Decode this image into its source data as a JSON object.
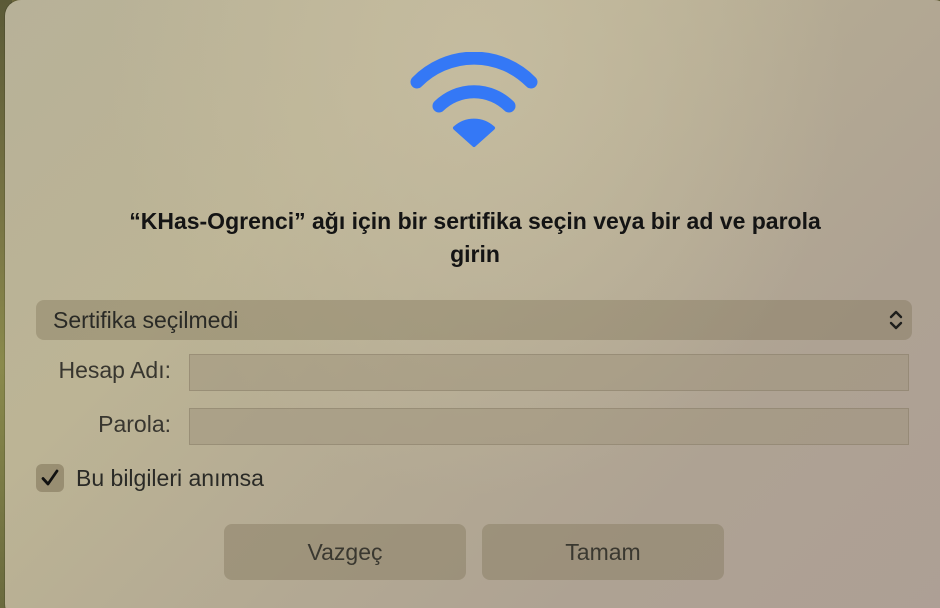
{
  "dialog": {
    "title": "“KHas-Ogrenci” ağı için bir sertifika seçin veya bir ad ve parola girin",
    "certificate_select": {
      "selected_value": "Sertifika seçilmedi",
      "icon": "chevron-up-down-icon"
    },
    "account_name": {
      "label": "Hesap Adı:",
      "value": ""
    },
    "password": {
      "label": "Parola:",
      "value": ""
    },
    "remember": {
      "label": "Bu bilgileri anımsa",
      "checked": true
    },
    "buttons": {
      "cancel_label": "Vazgeç",
      "ok_label": "Tamam"
    },
    "icon": "wifi-icon",
    "colors": {
      "wifi_blue": "#3478f6"
    }
  }
}
